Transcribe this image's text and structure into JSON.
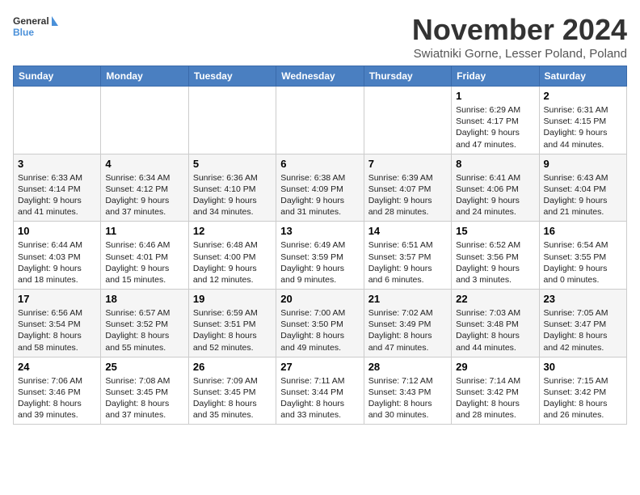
{
  "logo": {
    "general": "General",
    "blue": "Blue"
  },
  "header": {
    "month": "November 2024",
    "location": "Swiatniki Gorne, Lesser Poland, Poland"
  },
  "weekdays": [
    "Sunday",
    "Monday",
    "Tuesday",
    "Wednesday",
    "Thursday",
    "Friday",
    "Saturday"
  ],
  "weeks": [
    [
      {
        "day": "",
        "info": ""
      },
      {
        "day": "",
        "info": ""
      },
      {
        "day": "",
        "info": ""
      },
      {
        "day": "",
        "info": ""
      },
      {
        "day": "",
        "info": ""
      },
      {
        "day": "1",
        "info": "Sunrise: 6:29 AM\nSunset: 4:17 PM\nDaylight: 9 hours and 47 minutes."
      },
      {
        "day": "2",
        "info": "Sunrise: 6:31 AM\nSunset: 4:15 PM\nDaylight: 9 hours and 44 minutes."
      }
    ],
    [
      {
        "day": "3",
        "info": "Sunrise: 6:33 AM\nSunset: 4:14 PM\nDaylight: 9 hours and 41 minutes."
      },
      {
        "day": "4",
        "info": "Sunrise: 6:34 AM\nSunset: 4:12 PM\nDaylight: 9 hours and 37 minutes."
      },
      {
        "day": "5",
        "info": "Sunrise: 6:36 AM\nSunset: 4:10 PM\nDaylight: 9 hours and 34 minutes."
      },
      {
        "day": "6",
        "info": "Sunrise: 6:38 AM\nSunset: 4:09 PM\nDaylight: 9 hours and 31 minutes."
      },
      {
        "day": "7",
        "info": "Sunrise: 6:39 AM\nSunset: 4:07 PM\nDaylight: 9 hours and 28 minutes."
      },
      {
        "day": "8",
        "info": "Sunrise: 6:41 AM\nSunset: 4:06 PM\nDaylight: 9 hours and 24 minutes."
      },
      {
        "day": "9",
        "info": "Sunrise: 6:43 AM\nSunset: 4:04 PM\nDaylight: 9 hours and 21 minutes."
      }
    ],
    [
      {
        "day": "10",
        "info": "Sunrise: 6:44 AM\nSunset: 4:03 PM\nDaylight: 9 hours and 18 minutes."
      },
      {
        "day": "11",
        "info": "Sunrise: 6:46 AM\nSunset: 4:01 PM\nDaylight: 9 hours and 15 minutes."
      },
      {
        "day": "12",
        "info": "Sunrise: 6:48 AM\nSunset: 4:00 PM\nDaylight: 9 hours and 12 minutes."
      },
      {
        "day": "13",
        "info": "Sunrise: 6:49 AM\nSunset: 3:59 PM\nDaylight: 9 hours and 9 minutes."
      },
      {
        "day": "14",
        "info": "Sunrise: 6:51 AM\nSunset: 3:57 PM\nDaylight: 9 hours and 6 minutes."
      },
      {
        "day": "15",
        "info": "Sunrise: 6:52 AM\nSunset: 3:56 PM\nDaylight: 9 hours and 3 minutes."
      },
      {
        "day": "16",
        "info": "Sunrise: 6:54 AM\nSunset: 3:55 PM\nDaylight: 9 hours and 0 minutes."
      }
    ],
    [
      {
        "day": "17",
        "info": "Sunrise: 6:56 AM\nSunset: 3:54 PM\nDaylight: 8 hours and 58 minutes."
      },
      {
        "day": "18",
        "info": "Sunrise: 6:57 AM\nSunset: 3:52 PM\nDaylight: 8 hours and 55 minutes."
      },
      {
        "day": "19",
        "info": "Sunrise: 6:59 AM\nSunset: 3:51 PM\nDaylight: 8 hours and 52 minutes."
      },
      {
        "day": "20",
        "info": "Sunrise: 7:00 AM\nSunset: 3:50 PM\nDaylight: 8 hours and 49 minutes."
      },
      {
        "day": "21",
        "info": "Sunrise: 7:02 AM\nSunset: 3:49 PM\nDaylight: 8 hours and 47 minutes."
      },
      {
        "day": "22",
        "info": "Sunrise: 7:03 AM\nSunset: 3:48 PM\nDaylight: 8 hours and 44 minutes."
      },
      {
        "day": "23",
        "info": "Sunrise: 7:05 AM\nSunset: 3:47 PM\nDaylight: 8 hours and 42 minutes."
      }
    ],
    [
      {
        "day": "24",
        "info": "Sunrise: 7:06 AM\nSunset: 3:46 PM\nDaylight: 8 hours and 39 minutes."
      },
      {
        "day": "25",
        "info": "Sunrise: 7:08 AM\nSunset: 3:45 PM\nDaylight: 8 hours and 37 minutes."
      },
      {
        "day": "26",
        "info": "Sunrise: 7:09 AM\nSunset: 3:45 PM\nDaylight: 8 hours and 35 minutes."
      },
      {
        "day": "27",
        "info": "Sunrise: 7:11 AM\nSunset: 3:44 PM\nDaylight: 8 hours and 33 minutes."
      },
      {
        "day": "28",
        "info": "Sunrise: 7:12 AM\nSunset: 3:43 PM\nDaylight: 8 hours and 30 minutes."
      },
      {
        "day": "29",
        "info": "Sunrise: 7:14 AM\nSunset: 3:42 PM\nDaylight: 8 hours and 28 minutes."
      },
      {
        "day": "30",
        "info": "Sunrise: 7:15 AM\nSunset: 3:42 PM\nDaylight: 8 hours and 26 minutes."
      }
    ]
  ]
}
